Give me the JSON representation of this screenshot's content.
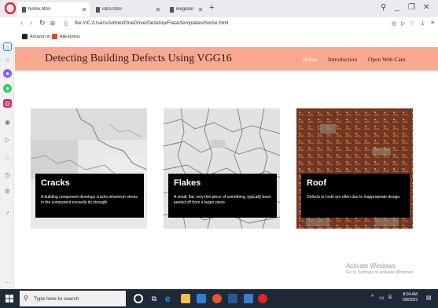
{
  "browser": {
    "tabs": [
      {
        "label": "home.html",
        "active": true
      },
      {
        "label": "intro.html",
        "active": false
      },
      {
        "label": "Register",
        "active": false
      }
    ],
    "address": "file:///C:/Users/Admin/OneDrive/Desktop/Flask/templates/home.html",
    "bookmarks": [
      {
        "label": "Amazon.in",
        "icon": "amazon-icon"
      },
      {
        "label": "AliExpress",
        "icon": "aliexpress-icon"
      }
    ]
  },
  "site": {
    "title": "Detecting Building Defects Using VGG16",
    "nav": {
      "home": "Home",
      "introduction": "Introduction",
      "webcam": "Open Web Cam"
    },
    "navbar_color": "#fba891"
  },
  "cards": [
    {
      "title": "Cracks",
      "text": "A building component develops cracks whenever stress in the component exceeds its strength"
    },
    {
      "title": "Flakes",
      "text": "A small, flat, very thin piece of something, typically been peeled off from a larger piece."
    },
    {
      "title": "Roof",
      "text": "Defects in roofs are often due to Inappropriate design."
    }
  ],
  "watermark": {
    "line1": "Activate Windows",
    "line2": "Go to Settings to activate Windows."
  },
  "taskbar": {
    "search_placeholder": "Type here to search",
    "time": "8:04 AM",
    "date": "6/8/2021"
  }
}
